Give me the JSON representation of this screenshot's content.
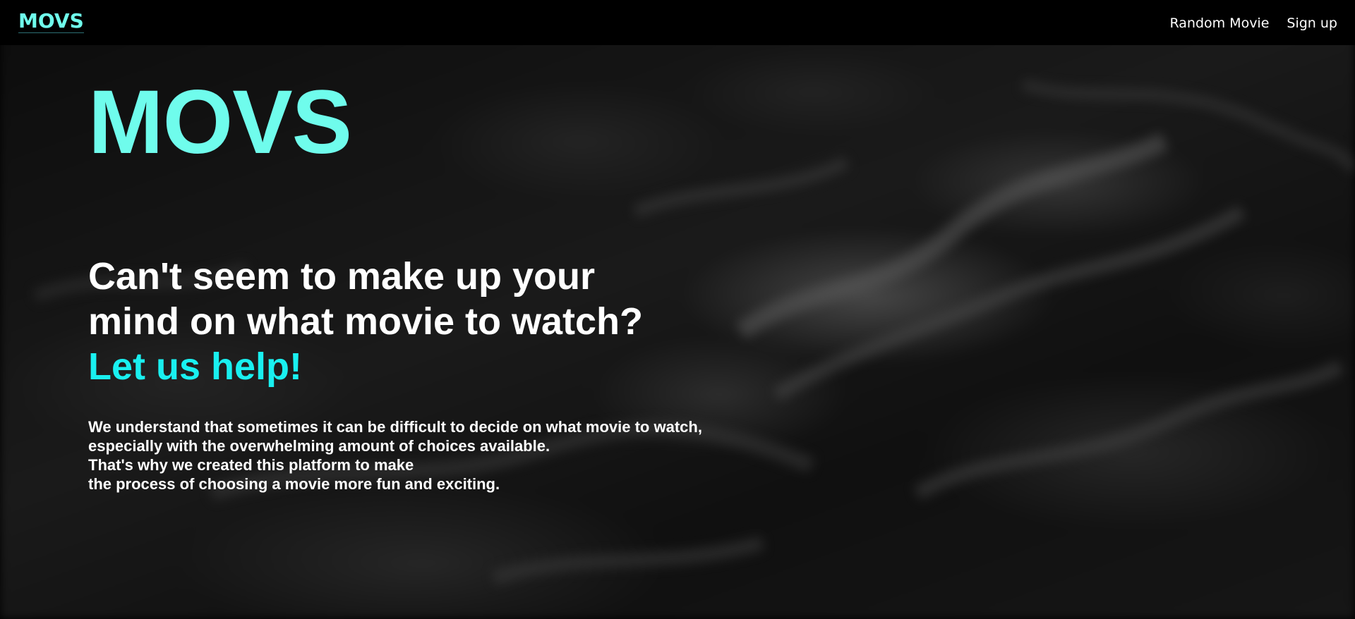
{
  "navbar": {
    "logo": "MOVS",
    "links": [
      {
        "label": "Random Movie"
      },
      {
        "label": "Sign up"
      }
    ]
  },
  "hero": {
    "title": "MOVS",
    "headline_line1": "Can't seem to make up your",
    "headline_line2": "mind on what movie to watch?",
    "headline_accent": "Let us help!",
    "description_lines": [
      "We understand that sometimes it can be difficult to decide on what movie to watch,",
      "especially with the overwhelming amount of choices available.",
      "That's why we created this platform to make",
      "the process of choosing a movie more fun and exciting."
    ]
  },
  "colors": {
    "accent": "#6ffcec",
    "accent_secondary": "#19f0f0",
    "text": "#ffffff",
    "navbar_bg": "#000000"
  }
}
